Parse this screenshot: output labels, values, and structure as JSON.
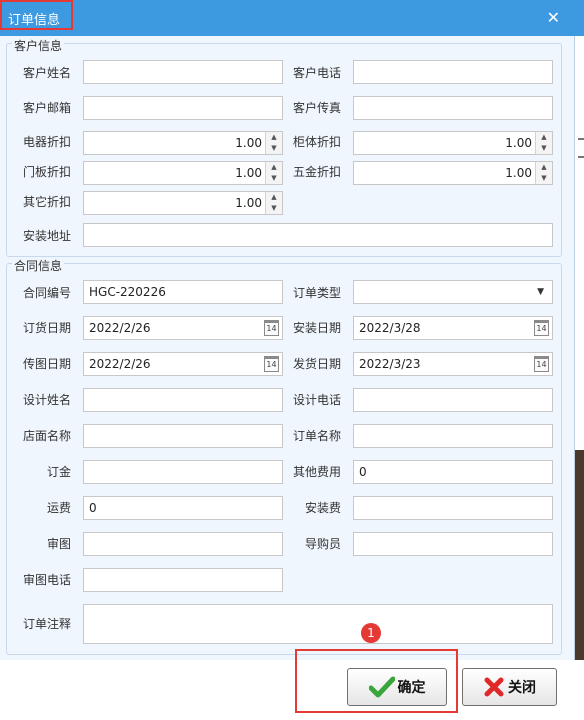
{
  "window": {
    "title": "订单信息"
  },
  "customer": {
    "group_title": "客户信息",
    "name_label": "客户姓名",
    "name_value": "",
    "phone_label": "客户电话",
    "phone_value": "",
    "email_label": "客户邮箱",
    "email_value": "",
    "fax_label": "客户传真",
    "fax_value": "",
    "appliance_discount_label": "电器折扣",
    "appliance_discount_value": "1.00",
    "cabinet_discount_label": "柜体折扣",
    "cabinet_discount_value": "1.00",
    "door_discount_label": "门板折扣",
    "door_discount_value": "1.00",
    "hardware_discount_label": "五金折扣",
    "hardware_discount_value": "1.00",
    "other_discount_label": "其它折扣",
    "other_discount_value": "1.00",
    "address_label": "安装地址",
    "address_value": ""
  },
  "contract": {
    "group_title": "合同信息",
    "number_label": "合同编号",
    "number_value": "HGC-220226",
    "order_type_label": "订单类型",
    "order_type_value": "",
    "order_date_label": "订货日期",
    "order_date_value": "2022/2/26",
    "install_date_label": "安装日期",
    "install_date_value": "2022/3/28",
    "drawing_date_label": "传图日期",
    "drawing_date_value": "2022/2/26",
    "ship_date_label": "发货日期",
    "ship_date_value": "2022/3/23",
    "designer_name_label": "设计姓名",
    "designer_name_value": "",
    "designer_phone_label": "设计电话",
    "designer_phone_value": "",
    "store_name_label": "店面名称",
    "store_name_value": "",
    "order_name_label": "订单名称",
    "order_name_value": "",
    "deposit_label": "订金",
    "deposit_value": "",
    "other_fees_label": "其他费用",
    "other_fees_value": "0",
    "shipping_label": "运费",
    "shipping_value": "0",
    "install_fee_label": "安装费",
    "install_fee_value": "",
    "review_label": "审图",
    "review_value": "",
    "guide_label": "导购员",
    "guide_value": "",
    "review_phone_label": "审图电话",
    "review_phone_value": "",
    "remark_label": "订单注释",
    "remark_value": ""
  },
  "buttons": {
    "confirm": "确定",
    "close": "关闭"
  },
  "annotation": {
    "badge": "1"
  },
  "icons": {
    "calendar_text": "14",
    "spin_up": "▲",
    "spin_down": "▼",
    "caret": "▼",
    "close_x": "✕",
    "check": "check-icon",
    "cross": "cross-icon"
  },
  "colors": {
    "titlebar": "#3d9ae0",
    "body": "#f0f6fd",
    "highlight": "#e53935"
  }
}
